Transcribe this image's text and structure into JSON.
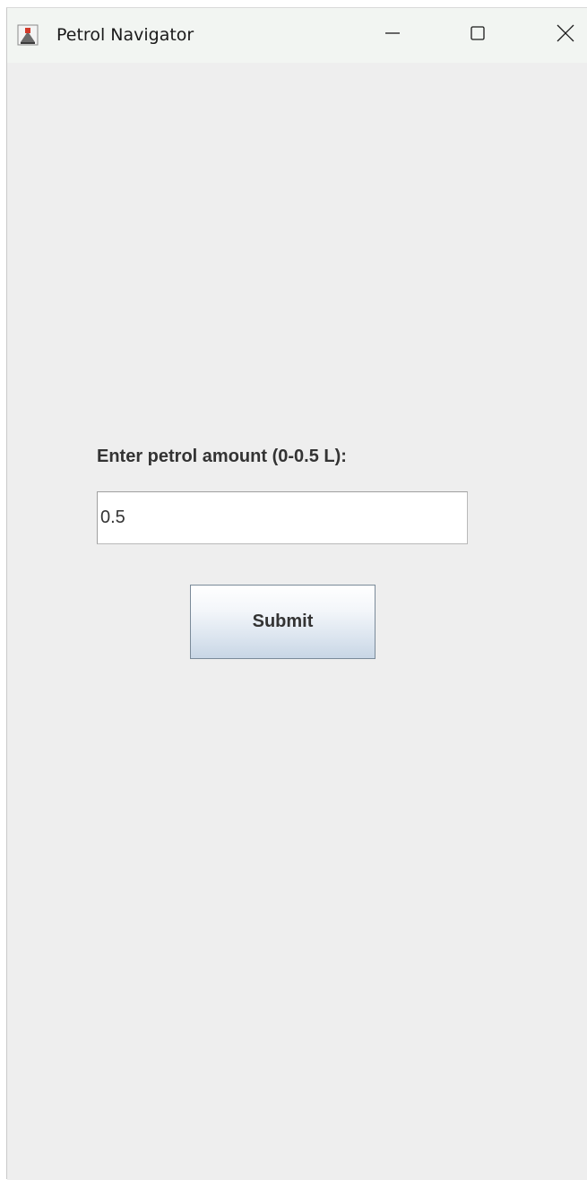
{
  "window": {
    "title": "Petrol Navigator",
    "app_icon": "java-cup-icon",
    "controls": {
      "minimize_icon": "minimize-icon",
      "maximize_icon": "maximize-icon",
      "close_icon": "close-icon"
    }
  },
  "form": {
    "label": "Enter petrol amount (0-0.5 L):",
    "amount_value": "0.5",
    "submit_label": "Submit"
  },
  "colors": {
    "background": "#eeeeee",
    "titlebar": "#f2f5f2",
    "text": "#333333",
    "button_top": "#ffffff",
    "button_bottom": "#c8d6e5"
  }
}
